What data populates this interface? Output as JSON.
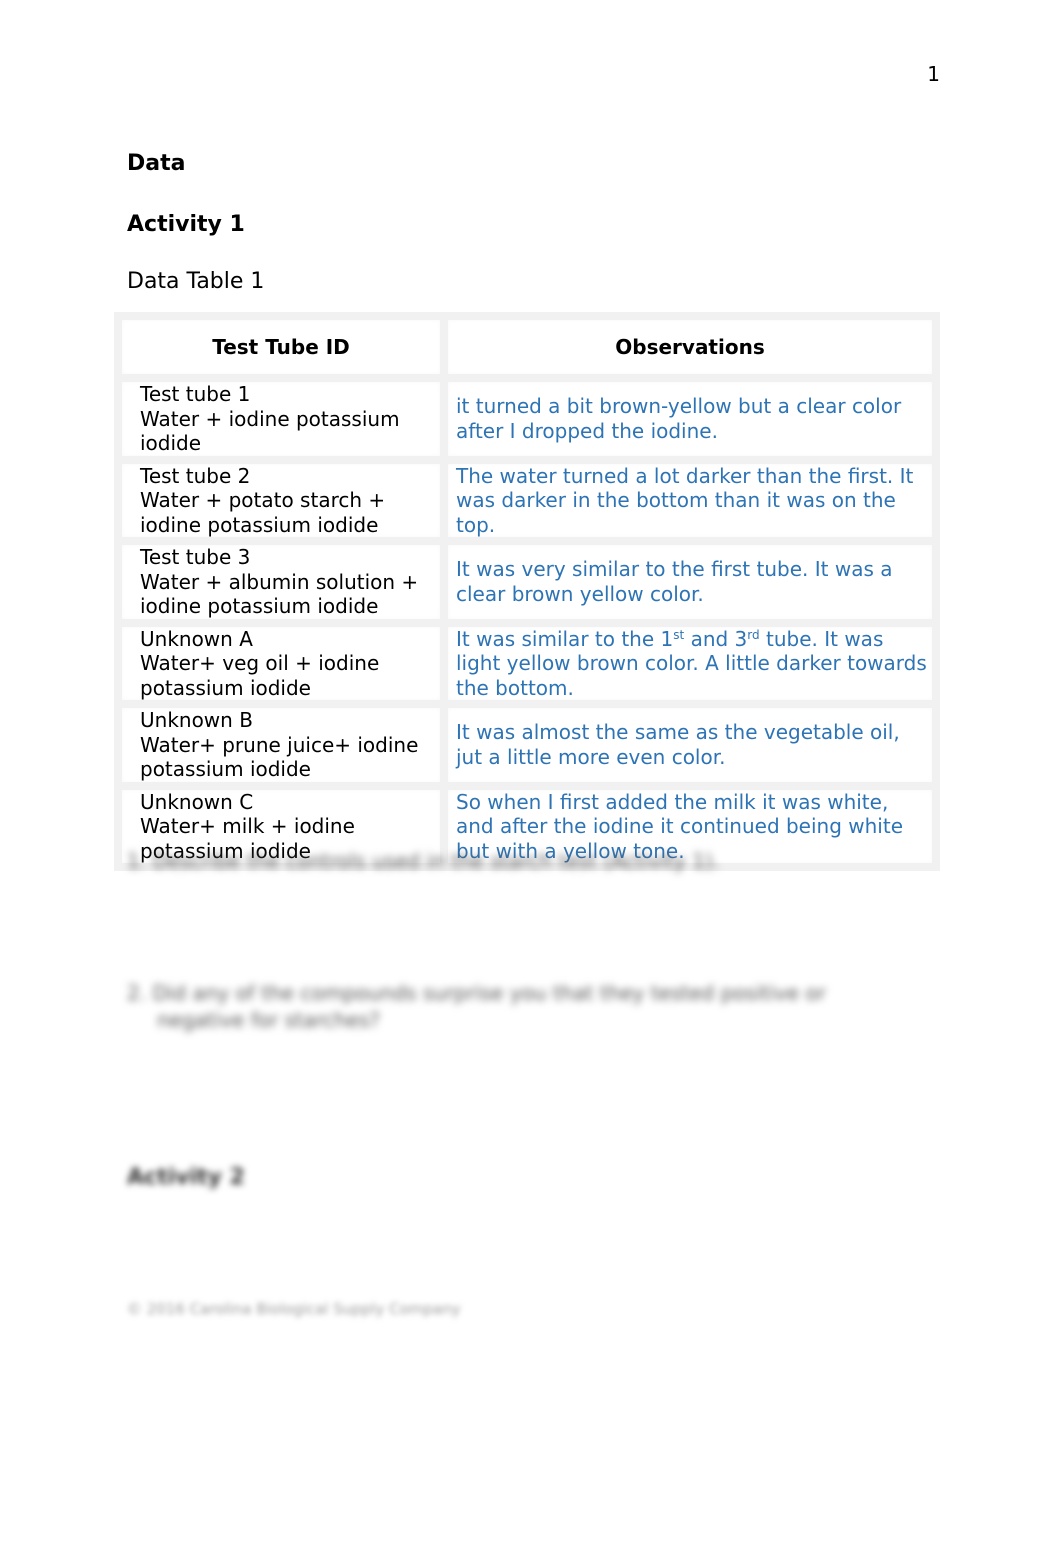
{
  "page": {
    "page_number": "1"
  },
  "headings": {
    "section": "Data",
    "activity": "Activity 1",
    "table_caption": "Data Table 1"
  },
  "table": {
    "columns": [
      "Test Tube ID",
      "Observations"
    ],
    "rows": [
      {
        "id_lines": [
          "Test tube 1",
          "Water + iodine potassium iodide"
        ],
        "observation_parts": [
          "it turned a bit brown-yellow but a clear color after I dropped the iodine."
        ]
      },
      {
        "id_lines": [
          "Test tube 2",
          "Water + potato starch + iodine potassium iodide"
        ],
        "observation_parts": [
          "The water turned a lot darker than the first. It was darker in the bottom than it was on the top."
        ]
      },
      {
        "id_lines": [
          "Test tube 3",
          "Water + albumin solution + iodine potassium iodide"
        ],
        "observation_parts": [
          "It was very similar to the first tube. It was a clear brown yellow color."
        ]
      },
      {
        "id_lines": [
          "Unknown A",
          "Water+ veg oil + iodine potassium iodide"
        ],
        "observation_parts": [
          "It was similar to the 1",
          "st",
          " and 3",
          "rd",
          " tube. It was light yellow brown color. A little darker towards the bottom."
        ]
      },
      {
        "id_lines": [
          "Unknown B",
          "Water+ prune juice+ iodine potassium iodide"
        ],
        "observation_parts": [
          "It was almost the same as the vegetable oil, jut a little more even color."
        ]
      },
      {
        "id_lines": [
          "Unknown C",
          "Water+ milk + iodine potassium iodide"
        ],
        "observation_parts": [
          "So when I first added the milk it was white, and after the iodine it continued  being white but with a yellow tone."
        ]
      }
    ]
  },
  "blurred": {
    "question_1": "1.  Describe the controls used in the starch test (Activity 1).",
    "question_2": "2.  Did any of the compounds surprise you that they tested positive or negative for starches?",
    "activity_2": "Activity 2",
    "footer": "© 2016 Carolina Biological Supply Company"
  },
  "colors": {
    "observation_text": "#2e74b5",
    "table_border": "#f1f1f1"
  }
}
